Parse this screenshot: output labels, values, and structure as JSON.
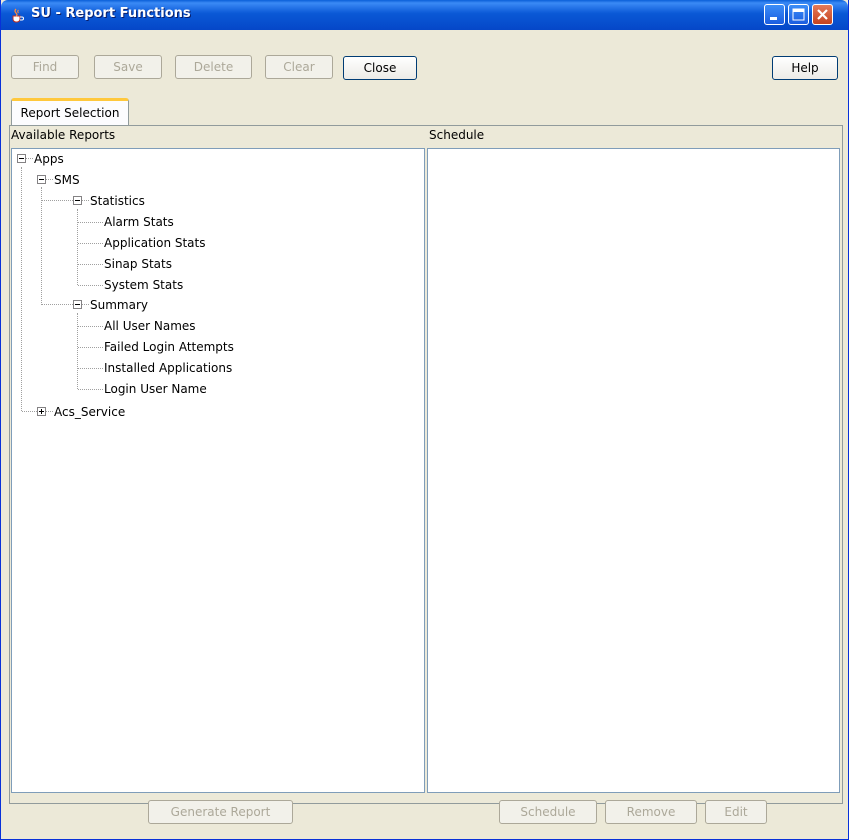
{
  "window": {
    "title": "SU - Report Functions",
    "icon": "java-cup-icon"
  },
  "toolbar": {
    "find": "Find",
    "save": "Save",
    "delete": "Delete",
    "clear": "Clear",
    "close": "Close",
    "help": "Help"
  },
  "tabs": [
    {
      "label": "Report Selection",
      "selected": true
    }
  ],
  "columns": {
    "available": "Available Reports",
    "schedule": "Schedule"
  },
  "tree": {
    "apps": "Apps",
    "sms": "SMS",
    "statistics": "Statistics",
    "statistics_items": [
      "Alarm Stats",
      "Application Stats",
      "Sinap Stats",
      "System Stats"
    ],
    "summary": "Summary",
    "summary_items": [
      "All User Names",
      "Failed Login Attempts",
      "Installed Applications",
      "Login User Name"
    ],
    "acs_service": "Acs_Service"
  },
  "footer": {
    "generate": "Generate Report",
    "schedule": "Schedule",
    "remove": "Remove",
    "edit": "Edit"
  },
  "colors": {
    "titlebar": "#0a58d6",
    "tab_accent": "#ffc83c",
    "window_bg": "#ece9d8"
  }
}
